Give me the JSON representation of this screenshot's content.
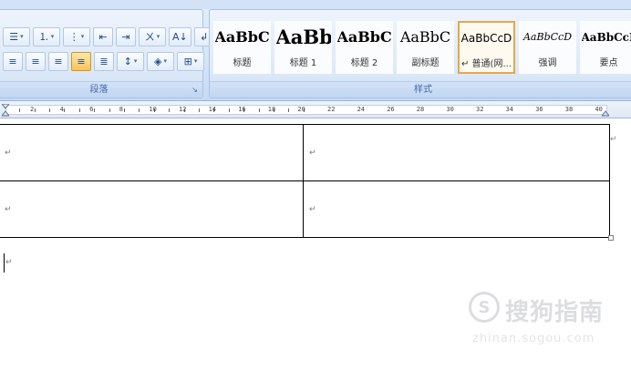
{
  "ribbon": {
    "paragraph_group": {
      "label": "段落",
      "row1": [
        {
          "name": "bullets-button",
          "glyph": "☰",
          "dropdown": true
        },
        {
          "name": "numbering-button",
          "glyph": "⒈",
          "dropdown": true
        },
        {
          "name": "multilevel-list-button",
          "glyph": "⋮",
          "dropdown": true
        },
        {
          "name": "decrease-indent-button",
          "glyph": "⇤"
        },
        {
          "name": "increase-indent-button",
          "glyph": "⇥"
        },
        {
          "name": "chinese-layout-button",
          "glyph": "ㄨ",
          "dropdown": true
        },
        {
          "name": "sort-button",
          "glyph": "A↓"
        },
        {
          "name": "show-marks-button",
          "glyph": "↲"
        }
      ],
      "row2": [
        {
          "name": "align-left-button",
          "glyph": "≡"
        },
        {
          "name": "align-center-button",
          "glyph": "≡"
        },
        {
          "name": "align-right-button",
          "glyph": "≡"
        },
        {
          "name": "justify-button",
          "glyph": "≡",
          "active": true
        },
        {
          "name": "distributed-button",
          "glyph": "≣"
        },
        {
          "name": "line-spacing-button",
          "glyph": "↕",
          "dropdown": true
        },
        {
          "name": "shading-button",
          "glyph": "◈",
          "dropdown": true
        },
        {
          "name": "borders-button",
          "glyph": "⊞",
          "dropdown": true
        }
      ]
    },
    "styles_group": {
      "label": "样式",
      "tiles": [
        {
          "preview": "AaBbC",
          "name": "标题",
          "size": 16,
          "bold": true
        },
        {
          "preview": "AaBb",
          "name": "标题 1",
          "size": 21,
          "bold": true
        },
        {
          "preview": "AaBbC",
          "name": "标题 2",
          "size": 16,
          "bold": true
        },
        {
          "preview": "AaBbC",
          "name": "副标题",
          "size": 16,
          "bold": false
        },
        {
          "preview": "AaBbCcD",
          "name": "↵ 普通(网...",
          "size": 12,
          "bold": false,
          "selected": true
        },
        {
          "preview": "AaBbCcD",
          "name": "强调",
          "size": 11,
          "italic": true
        },
        {
          "preview": "AaBbCcD",
          "name": "要点",
          "size": 12,
          "bold": true
        }
      ]
    }
  },
  "ruler": {
    "labels": [
      "2",
      "4",
      "6",
      "8",
      "10",
      "12",
      "14",
      "16",
      "18",
      "20",
      "22",
      "24",
      "26",
      "28",
      "30",
      "32",
      "34",
      "36",
      "38",
      "40"
    ]
  },
  "document": {
    "table": {
      "rows": [
        [
          "↵",
          "↵"
        ],
        [
          "↵",
          "↵"
        ]
      ]
    },
    "row_end_mark": "↵",
    "after_table_mark": "↵"
  },
  "watermark": {
    "logo_text": "S",
    "brand": "搜狗指南",
    "url": "zhinan.sogou.com"
  },
  "colors": {
    "ribbon_bg": "#d5e4f7",
    "selected_style_border": "#e5a74a",
    "active_button": "#f7c45a",
    "group_label_text": "#3e6aaa"
  }
}
